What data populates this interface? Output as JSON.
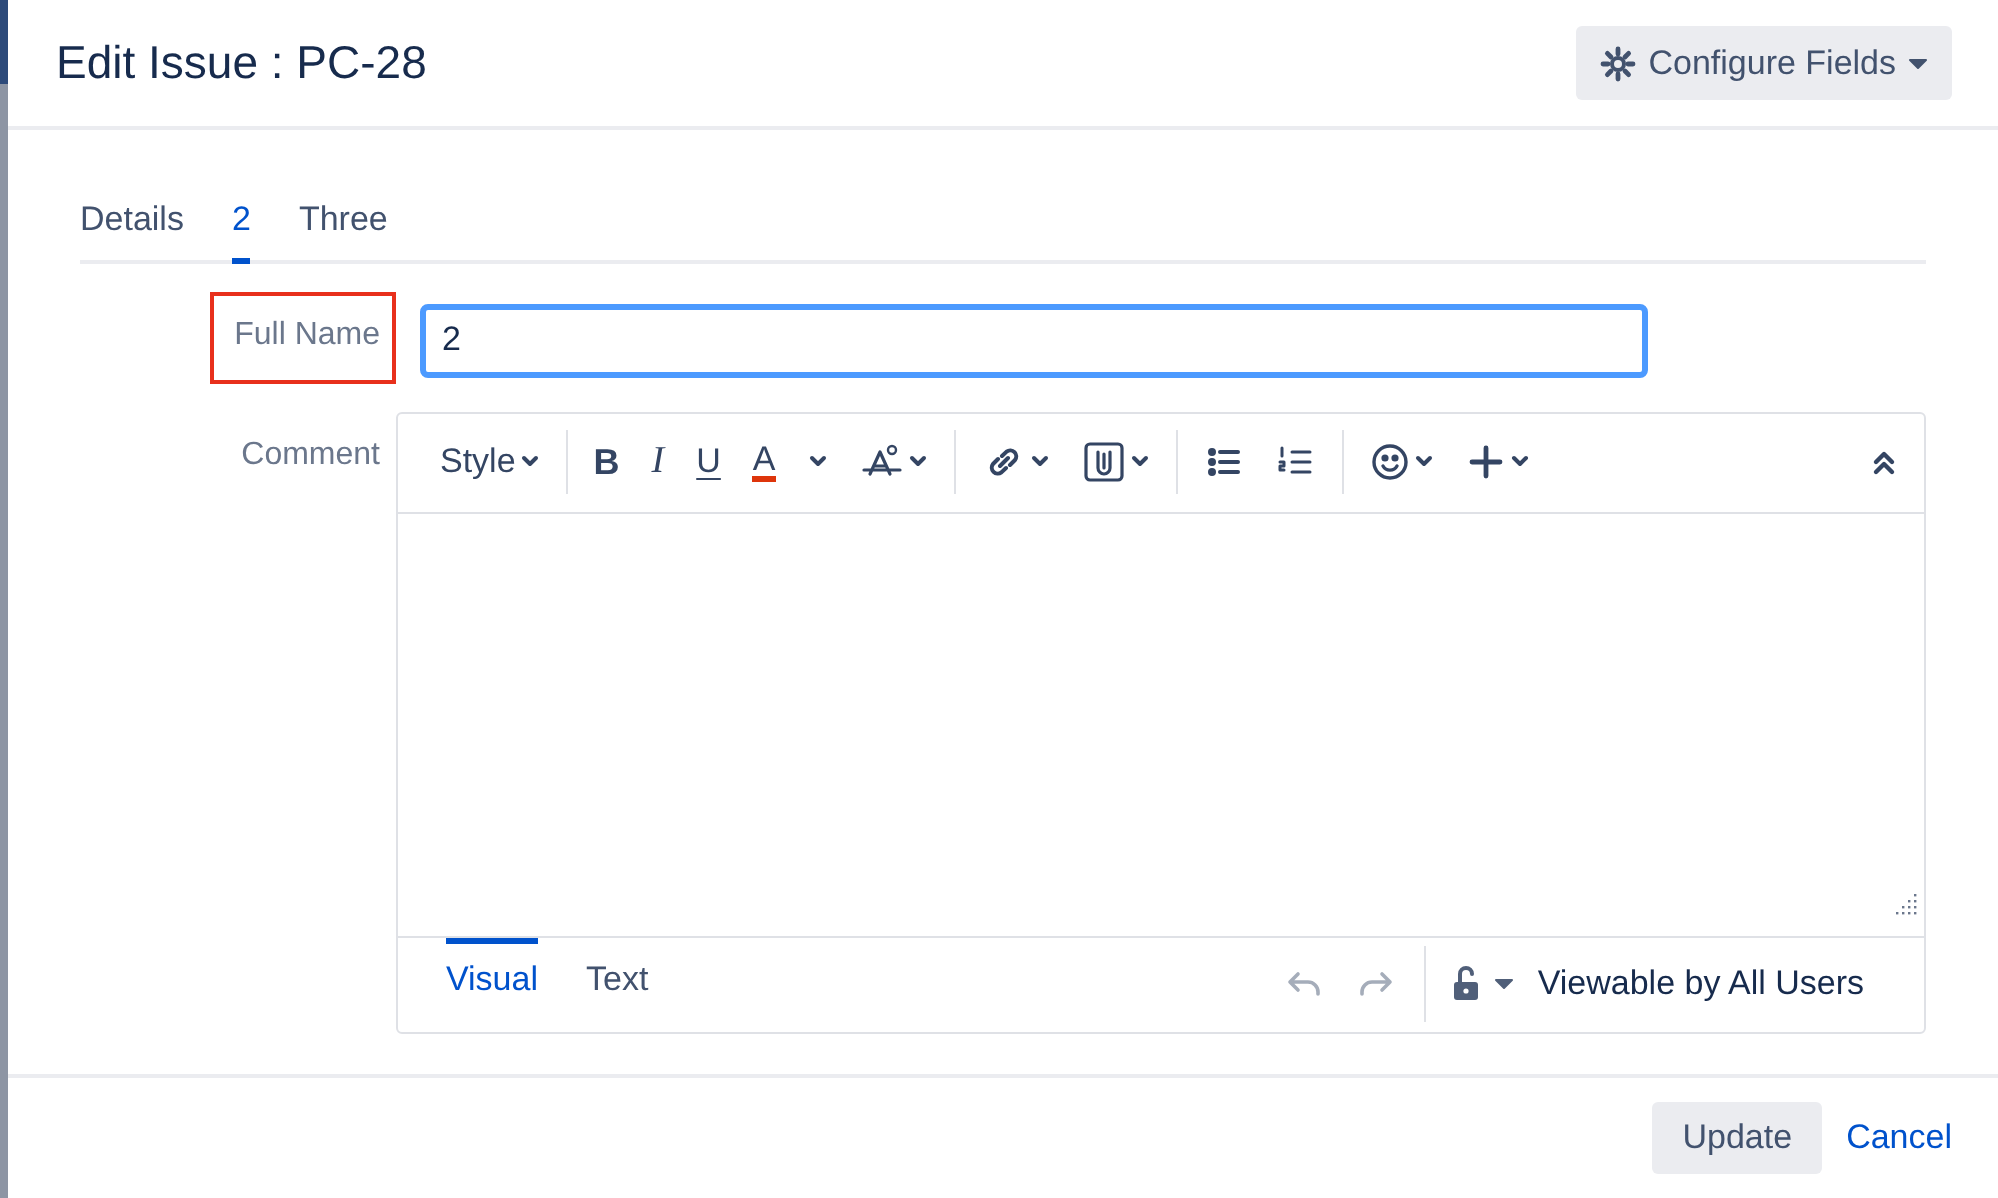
{
  "dialog": {
    "title": "Edit Issue : PC-28",
    "configure_button": {
      "label": "Configure Fields"
    }
  },
  "tabs": [
    {
      "label": "Details",
      "selected": false
    },
    {
      "label": "2",
      "selected": true
    },
    {
      "label": "Three",
      "selected": false
    }
  ],
  "fields": [
    {
      "kind": "text",
      "label": "Full Name",
      "value": "2",
      "highlighted": true,
      "focused": true
    },
    {
      "kind": "editor",
      "label": "Comment",
      "highlighted": false
    }
  ],
  "toolbar": {
    "groups": [
      [
        {
          "kind": "style",
          "label": "Style",
          "dropdown": true
        }
      ],
      [
        {
          "kind": "bold",
          "label": "B",
          "dropdown": false
        },
        {
          "kind": "italic",
          "label": "I",
          "dropdown": false
        },
        {
          "kind": "underline",
          "label": "U",
          "dropdown": false
        },
        {
          "kind": "color",
          "label": "A",
          "dropdown": true
        },
        {
          "kind": "format",
          "dropdown": true
        }
      ],
      [
        {
          "kind": "link",
          "dropdown": true
        },
        {
          "kind": "attachment",
          "dropdown": true
        }
      ],
      [
        {
          "kind": "bullet-list",
          "dropdown": false
        },
        {
          "kind": "numbered-list",
          "dropdown": false
        }
      ],
      [
        {
          "kind": "emoji",
          "dropdown": true
        },
        {
          "kind": "insert",
          "dropdown": true
        }
      ]
    ]
  },
  "editor_modes": [
    {
      "label": "Visual",
      "selected": true
    },
    {
      "label": "Text",
      "selected": false
    }
  ],
  "history": [
    {
      "kind": "undo",
      "disabled": true
    },
    {
      "kind": "redo",
      "disabled": true
    }
  ],
  "visibility": {
    "label": "Viewable by All Users"
  },
  "footer": {
    "update_button": "Update",
    "cancel_link": "Cancel"
  }
}
